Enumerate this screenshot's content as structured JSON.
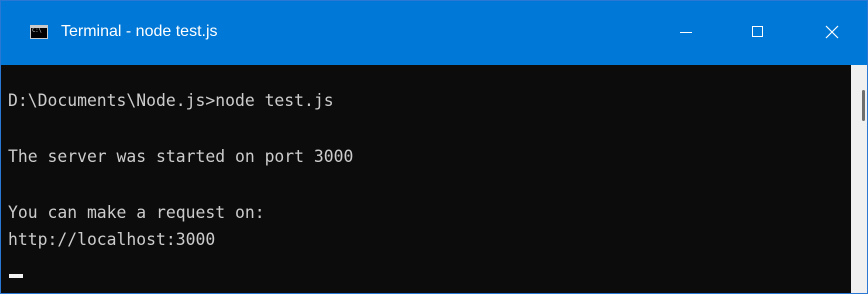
{
  "window": {
    "title": "Terminal - node test.js",
    "icon": "console-icon",
    "icon_prompt": "C:\\"
  },
  "controls": {
    "minimize": "minimize-icon",
    "maximize": "maximize-icon",
    "close": "close-icon"
  },
  "console": {
    "lines": [
      "D:\\Documents\\Node.js>node test.js",
      "The server was started on port 3000",
      "You can make a request on:",
      "http://localhost:3000"
    ]
  },
  "colors": {
    "titlebar": "#0078d7",
    "console_bg": "#0c0c0c",
    "console_text": "#cccccc"
  }
}
